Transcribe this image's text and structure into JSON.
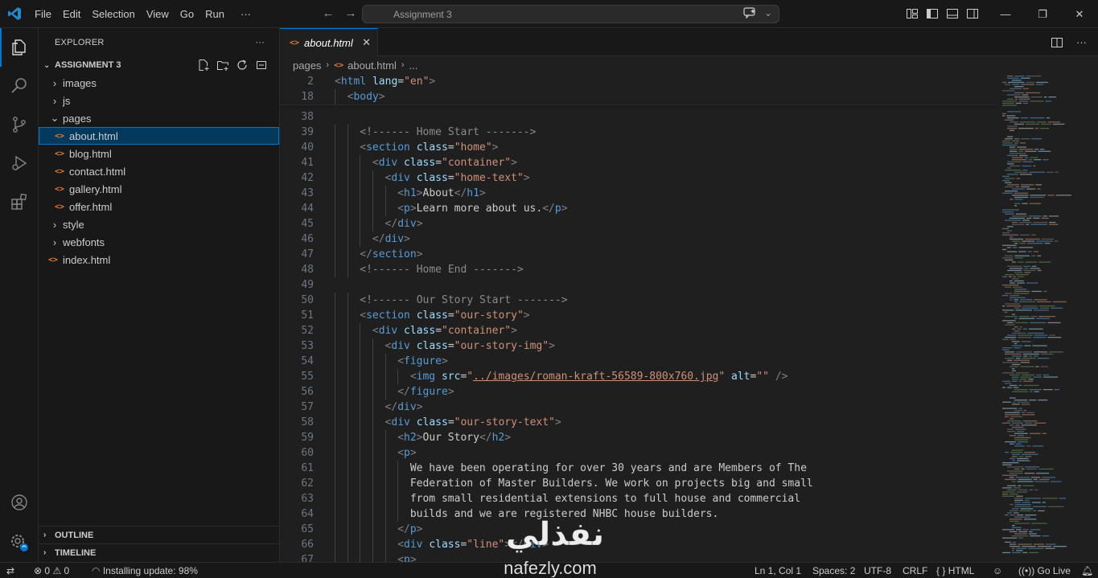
{
  "titlebar": {
    "menu": [
      "File",
      "Edit",
      "Selection",
      "View",
      "Go",
      "Run"
    ],
    "more": "···",
    "command_center": "Assignment 3"
  },
  "explorer": {
    "title": "EXPLORER",
    "more": "···",
    "folder": "ASSIGNMENT 3",
    "items": [
      {
        "label": "images",
        "kind": "folder",
        "depth": 1,
        "expanded": false
      },
      {
        "label": "js",
        "kind": "folder",
        "depth": 1,
        "expanded": false
      },
      {
        "label": "pages",
        "kind": "folder",
        "depth": 1,
        "expanded": true
      },
      {
        "label": "about.html",
        "kind": "html",
        "depth": 2,
        "selected": true
      },
      {
        "label": "blog.html",
        "kind": "html",
        "depth": 2
      },
      {
        "label": "contact.html",
        "kind": "html",
        "depth": 2
      },
      {
        "label": "gallery.html",
        "kind": "html",
        "depth": 2
      },
      {
        "label": "offer.html",
        "kind": "html",
        "depth": 2
      },
      {
        "label": "style",
        "kind": "folder",
        "depth": 1,
        "expanded": false
      },
      {
        "label": "webfonts",
        "kind": "folder",
        "depth": 1,
        "expanded": false
      },
      {
        "label": "index.html",
        "kind": "html",
        "depth": 1
      }
    ],
    "outline": "OUTLINE",
    "timeline": "TIMELINE"
  },
  "editor": {
    "tab": {
      "label": "about.html",
      "close": "✕"
    },
    "breadcrumb": [
      "pages",
      "about.html",
      "..."
    ],
    "lines": [
      {
        "n": "2",
        "indent": 0,
        "html": "<span class=\"br\">&lt;</span><span class=\"tag\">html</span> <span class=\"attr\">lang</span>=<span class=\"str\">\"en\"</span><span class=\"br\">&gt;</span>"
      },
      {
        "n": "18",
        "indent": 1,
        "html": "<span class=\"br\">&lt;</span><span class=\"tag\">body</span><span class=\"br\">&gt;</span>"
      },
      {
        "n": "38",
        "indent": 0,
        "html": ""
      },
      {
        "n": "39",
        "indent": 2,
        "html": "<span class=\"cmtg\">&lt;!------ Home Start -------&gt;</span>"
      },
      {
        "n": "40",
        "indent": 2,
        "html": "<span class=\"br\">&lt;</span><span class=\"tag\">section</span> <span class=\"attr\">class</span>=<span class=\"str\">\"home\"</span><span class=\"br\">&gt;</span>"
      },
      {
        "n": "41",
        "indent": 3,
        "html": "<span class=\"br\">&lt;</span><span class=\"tag\">div</span> <span class=\"attr\">class</span>=<span class=\"str\">\"container\"</span><span class=\"br\">&gt;</span>"
      },
      {
        "n": "42",
        "indent": 4,
        "html": "<span class=\"br\">&lt;</span><span class=\"tag\">div</span> <span class=\"attr\">class</span>=<span class=\"str\">\"home-text\"</span><span class=\"br\">&gt;</span>"
      },
      {
        "n": "43",
        "indent": 5,
        "html": "<span class=\"br\">&lt;</span><span class=\"tag\">h1</span><span class=\"br\">&gt;</span>About<span class=\"br\">&lt;/</span><span class=\"tag\">h1</span><span class=\"br\">&gt;</span>"
      },
      {
        "n": "44",
        "indent": 5,
        "html": "<span class=\"br\">&lt;</span><span class=\"tag\">p</span><span class=\"br\">&gt;</span>Learn more about us.<span class=\"br\">&lt;/</span><span class=\"tag\">p</span><span class=\"br\">&gt;</span>"
      },
      {
        "n": "45",
        "indent": 4,
        "html": "<span class=\"br\">&lt;/</span><span class=\"tag\">div</span><span class=\"br\">&gt;</span>"
      },
      {
        "n": "46",
        "indent": 3,
        "html": "<span class=\"br\">&lt;/</span><span class=\"tag\">div</span><span class=\"br\">&gt;</span>"
      },
      {
        "n": "47",
        "indent": 2,
        "html": "<span class=\"br\">&lt;/</span><span class=\"tag\">section</span><span class=\"br\">&gt;</span>"
      },
      {
        "n": "48",
        "indent": 2,
        "html": "<span class=\"cmtg\">&lt;!------ Home End -------&gt;</span>"
      },
      {
        "n": "49",
        "indent": 0,
        "html": ""
      },
      {
        "n": "50",
        "indent": 2,
        "html": "<span class=\"cmtg\">&lt;!------ Our Story Start -------&gt;</span>"
      },
      {
        "n": "51",
        "indent": 2,
        "html": "<span class=\"br\">&lt;</span><span class=\"tag\">section</span> <span class=\"attr\">class</span>=<span class=\"str\">\"our-story\"</span><span class=\"br\">&gt;</span>"
      },
      {
        "n": "52",
        "indent": 3,
        "html": "<span class=\"br\">&lt;</span><span class=\"tag\">div</span> <span class=\"attr\">class</span>=<span class=\"str\">\"container\"</span><span class=\"br\">&gt;</span>"
      },
      {
        "n": "53",
        "indent": 4,
        "html": "<span class=\"br\">&lt;</span><span class=\"tag\">div</span> <span class=\"attr\">class</span>=<span class=\"str\">\"our-story-img\"</span><span class=\"br\">&gt;</span>"
      },
      {
        "n": "54",
        "indent": 5,
        "html": "<span class=\"br\">&lt;</span><span class=\"tag\">figure</span><span class=\"br\">&gt;</span>"
      },
      {
        "n": "55",
        "indent": 6,
        "html": "<span class=\"br\">&lt;</span><span class=\"tag\">img</span> <span class=\"attr\">src</span>=<span class=\"str\">\"</span><span class=\"link\">../images/roman-kraft-56589-800x760.jpg</span><span class=\"str\">\"</span> <span class=\"attr\">alt</span>=<span class=\"str\">\"\"</span> <span class=\"br\">/&gt;</span>"
      },
      {
        "n": "56",
        "indent": 5,
        "html": "<span class=\"br\">&lt;/</span><span class=\"tag\">figure</span><span class=\"br\">&gt;</span>"
      },
      {
        "n": "57",
        "indent": 4,
        "html": "<span class=\"br\">&lt;/</span><span class=\"tag\">div</span><span class=\"br\">&gt;</span>"
      },
      {
        "n": "58",
        "indent": 4,
        "html": "<span class=\"br\">&lt;</span><span class=\"tag\">div</span> <span class=\"attr\">class</span>=<span class=\"str\">\"our-story-text\"</span><span class=\"br\">&gt;</span>"
      },
      {
        "n": "59",
        "indent": 5,
        "html": "<span class=\"br\">&lt;</span><span class=\"tag\">h2</span><span class=\"br\">&gt;</span>Our Story<span class=\"br\">&lt;/</span><span class=\"tag\">h2</span><span class=\"br\">&gt;</span>"
      },
      {
        "n": "60",
        "indent": 5,
        "html": "<span class=\"br\">&lt;</span><span class=\"tag\">p</span><span class=\"br\">&gt;</span>"
      },
      {
        "n": "61",
        "indent": 6,
        "html": "We have been operating for over 30 years and are Members of The"
      },
      {
        "n": "62",
        "indent": 6,
        "html": "Federation of Master Builders. We work on projects big and small"
      },
      {
        "n": "63",
        "indent": 6,
        "html": "from small residential extensions to full house and commercial"
      },
      {
        "n": "64",
        "indent": 6,
        "html": "builds and we are registered NHBC house builders."
      },
      {
        "n": "65",
        "indent": 5,
        "html": "<span class=\"br\">&lt;/</span><span class=\"tag\">p</span><span class=\"br\">&gt;</span>"
      },
      {
        "n": "66",
        "indent": 5,
        "html": "<span class=\"br\">&lt;</span><span class=\"tag\">div</span> <span class=\"attr\">class</span>=<span class=\"str\">\"line\"</span><span class=\"br\">&gt;&lt;/</span><span class=\"tag\">div</span><span class=\"br\">&gt;</span>"
      },
      {
        "n": "67",
        "indent": 5,
        "html": "<span class=\"br\">&lt;</span><span class=\"tag\">p</span><span class=\"br\">&gt;</span>"
      }
    ]
  },
  "statusbar": {
    "errors": "0",
    "warnings": "0",
    "update": "Installing update: 98%",
    "position": "Ln 1, Col 1",
    "spaces": "Spaces: 2",
    "encoding": "UTF-8",
    "eol": "CRLF",
    "language": "HTML",
    "golive": "Go Live"
  },
  "watermark": {
    "arabic": "نفذلي",
    "latin": "nafezly.com"
  },
  "colors": {
    "accent": "#0078d4",
    "html_icon": "#e37933",
    "tag": "#569cd6",
    "attr": "#9cdcfe",
    "string": "#ce9178"
  }
}
